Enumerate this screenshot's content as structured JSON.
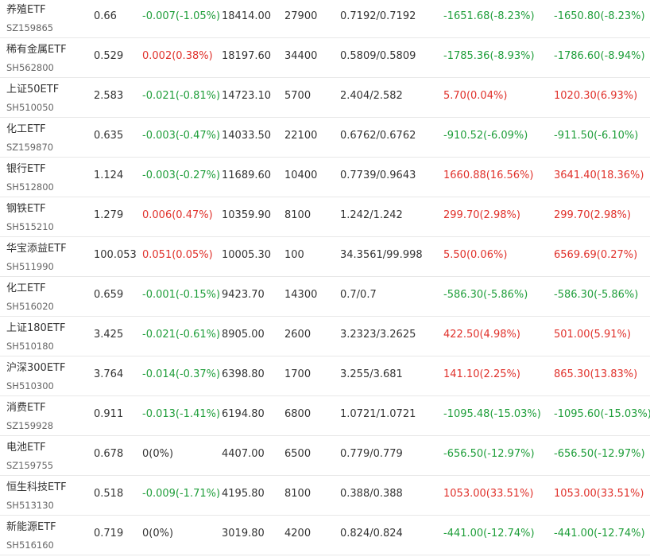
{
  "colors": {
    "up": "#e0312b",
    "down": "#1f9e3a",
    "flat": "#333333"
  },
  "rows": [
    {
      "name": "养殖ETF",
      "code": "SZ159865",
      "price": "0.66",
      "change": "-0.007(-1.05%)",
      "change_dir": "down",
      "market_value": "18414.00",
      "quantity": "27900",
      "cost": "0.7192/0.7192",
      "day_pl": "-1651.68(-8.23%)",
      "day_pl_dir": "down",
      "total_pl": "-1650.80(-8.23%)",
      "total_pl_dir": "down"
    },
    {
      "name": "稀有金属ETF",
      "code": "SH562800",
      "price": "0.529",
      "change": "0.002(0.38%)",
      "change_dir": "up",
      "market_value": "18197.60",
      "quantity": "34400",
      "cost": "0.5809/0.5809",
      "day_pl": "-1785.36(-8.93%)",
      "day_pl_dir": "down",
      "total_pl": "-1786.60(-8.94%)",
      "total_pl_dir": "down"
    },
    {
      "name": "上证50ETF",
      "code": "SH510050",
      "price": "2.583",
      "change": "-0.021(-0.81%)",
      "change_dir": "down",
      "market_value": "14723.10",
      "quantity": "5700",
      "cost": "2.404/2.582",
      "day_pl": "5.70(0.04%)",
      "day_pl_dir": "up",
      "total_pl": "1020.30(6.93%)",
      "total_pl_dir": "up"
    },
    {
      "name": "化工ETF",
      "code": "SZ159870",
      "price": "0.635",
      "change": "-0.003(-0.47%)",
      "change_dir": "down",
      "market_value": "14033.50",
      "quantity": "22100",
      "cost": "0.6762/0.6762",
      "day_pl": "-910.52(-6.09%)",
      "day_pl_dir": "down",
      "total_pl": "-911.50(-6.10%)",
      "total_pl_dir": "down"
    },
    {
      "name": "银行ETF",
      "code": "SH512800",
      "price": "1.124",
      "change": "-0.003(-0.27%)",
      "change_dir": "down",
      "market_value": "11689.60",
      "quantity": "10400",
      "cost": "0.7739/0.9643",
      "day_pl": "1660.88(16.56%)",
      "day_pl_dir": "up",
      "total_pl": "3641.40(18.36%)",
      "total_pl_dir": "up"
    },
    {
      "name": "钢铁ETF",
      "code": "SH515210",
      "price": "1.279",
      "change": "0.006(0.47%)",
      "change_dir": "up",
      "market_value": "10359.90",
      "quantity": "8100",
      "cost": "1.242/1.242",
      "day_pl": "299.70(2.98%)",
      "day_pl_dir": "up",
      "total_pl": "299.70(2.98%)",
      "total_pl_dir": "up"
    },
    {
      "name": "华宝添益ETF",
      "code": "SH511990",
      "price": "100.053",
      "change": "0.051(0.05%)",
      "change_dir": "up",
      "market_value": "10005.30",
      "quantity": "100",
      "cost": "34.3561/99.998",
      "day_pl": "5.50(0.06%)",
      "day_pl_dir": "up",
      "total_pl": "6569.69(0.27%)",
      "total_pl_dir": "up"
    },
    {
      "name": "化工ETF",
      "code": "SH516020",
      "price": "0.659",
      "change": "-0.001(-0.15%)",
      "change_dir": "down",
      "market_value": "9423.70",
      "quantity": "14300",
      "cost": "0.7/0.7",
      "day_pl": "-586.30(-5.86%)",
      "day_pl_dir": "down",
      "total_pl": "-586.30(-5.86%)",
      "total_pl_dir": "down"
    },
    {
      "name": "上证180ETF",
      "code": "SH510180",
      "price": "3.425",
      "change": "-0.021(-0.61%)",
      "change_dir": "down",
      "market_value": "8905.00",
      "quantity": "2600",
      "cost": "3.2323/3.2625",
      "day_pl": "422.50(4.98%)",
      "day_pl_dir": "up",
      "total_pl": "501.00(5.91%)",
      "total_pl_dir": "up"
    },
    {
      "name": "沪深300ETF",
      "code": "SH510300",
      "price": "3.764",
      "change": "-0.014(-0.37%)",
      "change_dir": "down",
      "market_value": "6398.80",
      "quantity": "1700",
      "cost": "3.255/3.681",
      "day_pl": "141.10(2.25%)",
      "day_pl_dir": "up",
      "total_pl": "865.30(13.83%)",
      "total_pl_dir": "up"
    },
    {
      "name": "消费ETF",
      "code": "SZ159928",
      "price": "0.911",
      "change": "-0.013(-1.41%)",
      "change_dir": "down",
      "market_value": "6194.80",
      "quantity": "6800",
      "cost": "1.0721/1.0721",
      "day_pl": "-1095.48(-15.03%)",
      "day_pl_dir": "down",
      "total_pl": "-1095.60(-15.03%)",
      "total_pl_dir": "down"
    },
    {
      "name": "电池ETF",
      "code": "SZ159755",
      "price": "0.678",
      "change": "0(0%)",
      "change_dir": "flat",
      "market_value": "4407.00",
      "quantity": "6500",
      "cost": "0.779/0.779",
      "day_pl": "-656.50(-12.97%)",
      "day_pl_dir": "down",
      "total_pl": "-656.50(-12.97%)",
      "total_pl_dir": "down"
    },
    {
      "name": "恒生科技ETF",
      "code": "SH513130",
      "price": "0.518",
      "change": "-0.009(-1.71%)",
      "change_dir": "down",
      "market_value": "4195.80",
      "quantity": "8100",
      "cost": "0.388/0.388",
      "day_pl": "1053.00(33.51%)",
      "day_pl_dir": "up",
      "total_pl": "1053.00(33.51%)",
      "total_pl_dir": "up"
    },
    {
      "name": "新能源ETF",
      "code": "SH516160",
      "price": "0.719",
      "change": "0(0%)",
      "change_dir": "flat",
      "market_value": "3019.80",
      "quantity": "4200",
      "cost": "0.824/0.824",
      "day_pl": "-441.00(-12.74%)",
      "day_pl_dir": "down",
      "total_pl": "-441.00(-12.74%)",
      "total_pl_dir": "down"
    }
  ]
}
